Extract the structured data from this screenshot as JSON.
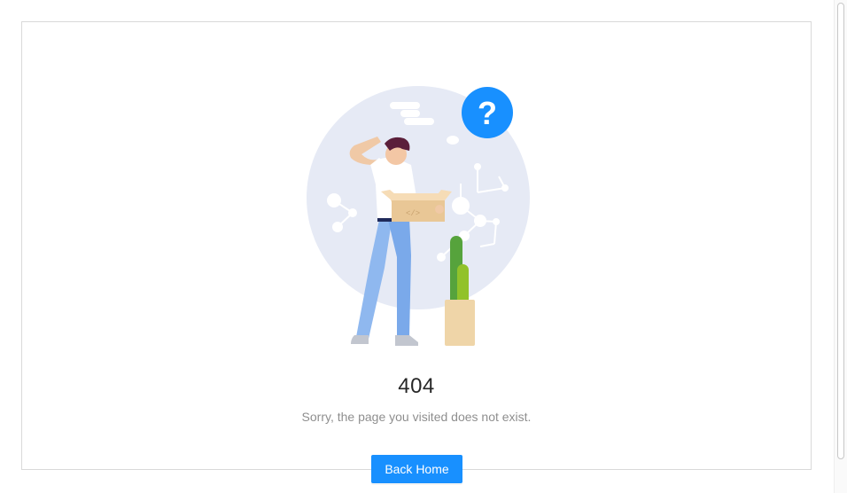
{
  "result": {
    "status_code": "404",
    "message": "Sorry, the page you visited does not exist.",
    "illustration_icon": "person-confused-with-box-illustration",
    "question_badge_icon": "question-mark-icon",
    "question_glyph": "?"
  },
  "actions": {
    "back_home_label": "Back Home"
  },
  "colors": {
    "primary": "#1890ff",
    "circle_bg": "#e6eaf5",
    "card_border": "#d9d9d9"
  }
}
